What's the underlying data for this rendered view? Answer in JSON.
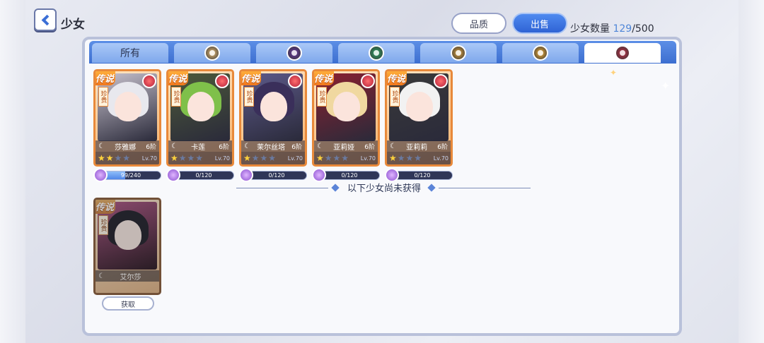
{
  "header": {
    "title": "少女",
    "quality_label": "品质",
    "sell_label": "出售",
    "count_prefix": "少女数量 ",
    "count_current": "129",
    "count_total": "/500"
  },
  "tabs": [
    {
      "label": "所有",
      "icon": "all",
      "color": ""
    },
    {
      "label": "",
      "icon": "light-element-icon",
      "color": "#f0c27a"
    },
    {
      "label": "",
      "icon": "dark-element-icon",
      "color": "#6b3ba8"
    },
    {
      "label": "",
      "icon": "nature-element-icon",
      "color": "#2fa86a"
    },
    {
      "label": "",
      "icon": "water-element-icon",
      "color": "#e2a640"
    },
    {
      "label": "",
      "icon": "sun-element-icon",
      "color": "#f5b23a"
    },
    {
      "label": "",
      "icon": "fire-element-icon",
      "color": "#c7304a"
    }
  ],
  "active_tab": 6,
  "cards": [
    {
      "badge": "传说",
      "rarity": "珍贵",
      "name": "莎雅娜",
      "rank": "6阶",
      "stars": 2,
      "level": "Lv.70",
      "exp": "99/240",
      "exp_fraction": 0.41,
      "hair": "#e8e8ee",
      "bg": "#c9c3cf"
    },
    {
      "badge": "传说",
      "rarity": "珍贵",
      "name": "卡莲",
      "rank": "6阶",
      "stars": 1,
      "level": "Lv.70",
      "exp": "0/120",
      "exp_fraction": 0,
      "hair": "#7fc04a",
      "bg": "#4d5a3a"
    },
    {
      "badge": "传说",
      "rarity": "珍贵",
      "name": "茉尔丝塔",
      "rank": "6阶",
      "stars": 1,
      "level": "Lv.70",
      "exp": "0/120",
      "exp_fraction": 0,
      "hair": "#3a2f5a",
      "bg": "#5d5a8a"
    },
    {
      "badge": "传说",
      "rarity": "珍贵",
      "name": "亚莉娅",
      "rank": "6阶",
      "stars": 1,
      "level": "Lv.70",
      "exp": "0/120",
      "exp_fraction": 0,
      "hair": "#f0d8a0",
      "bg": "#8a2030"
    },
    {
      "badge": "传说",
      "rarity": "珍贵",
      "name": "亚莉莉",
      "rank": "6阶",
      "stars": 1,
      "level": "Lv.70",
      "exp": "0/120",
      "exp_fraction": 0,
      "hair": "#f2f2f2",
      "bg": "#3a3a3a"
    }
  ],
  "divider_text": "以下少女尚未获得",
  "locked_card": {
    "badge": "传说",
    "rarity": "珍贵",
    "name": "艾尔莎",
    "obtain_label": "获取",
    "hair": "#2a2a3a",
    "bg": "#d8509a"
  }
}
